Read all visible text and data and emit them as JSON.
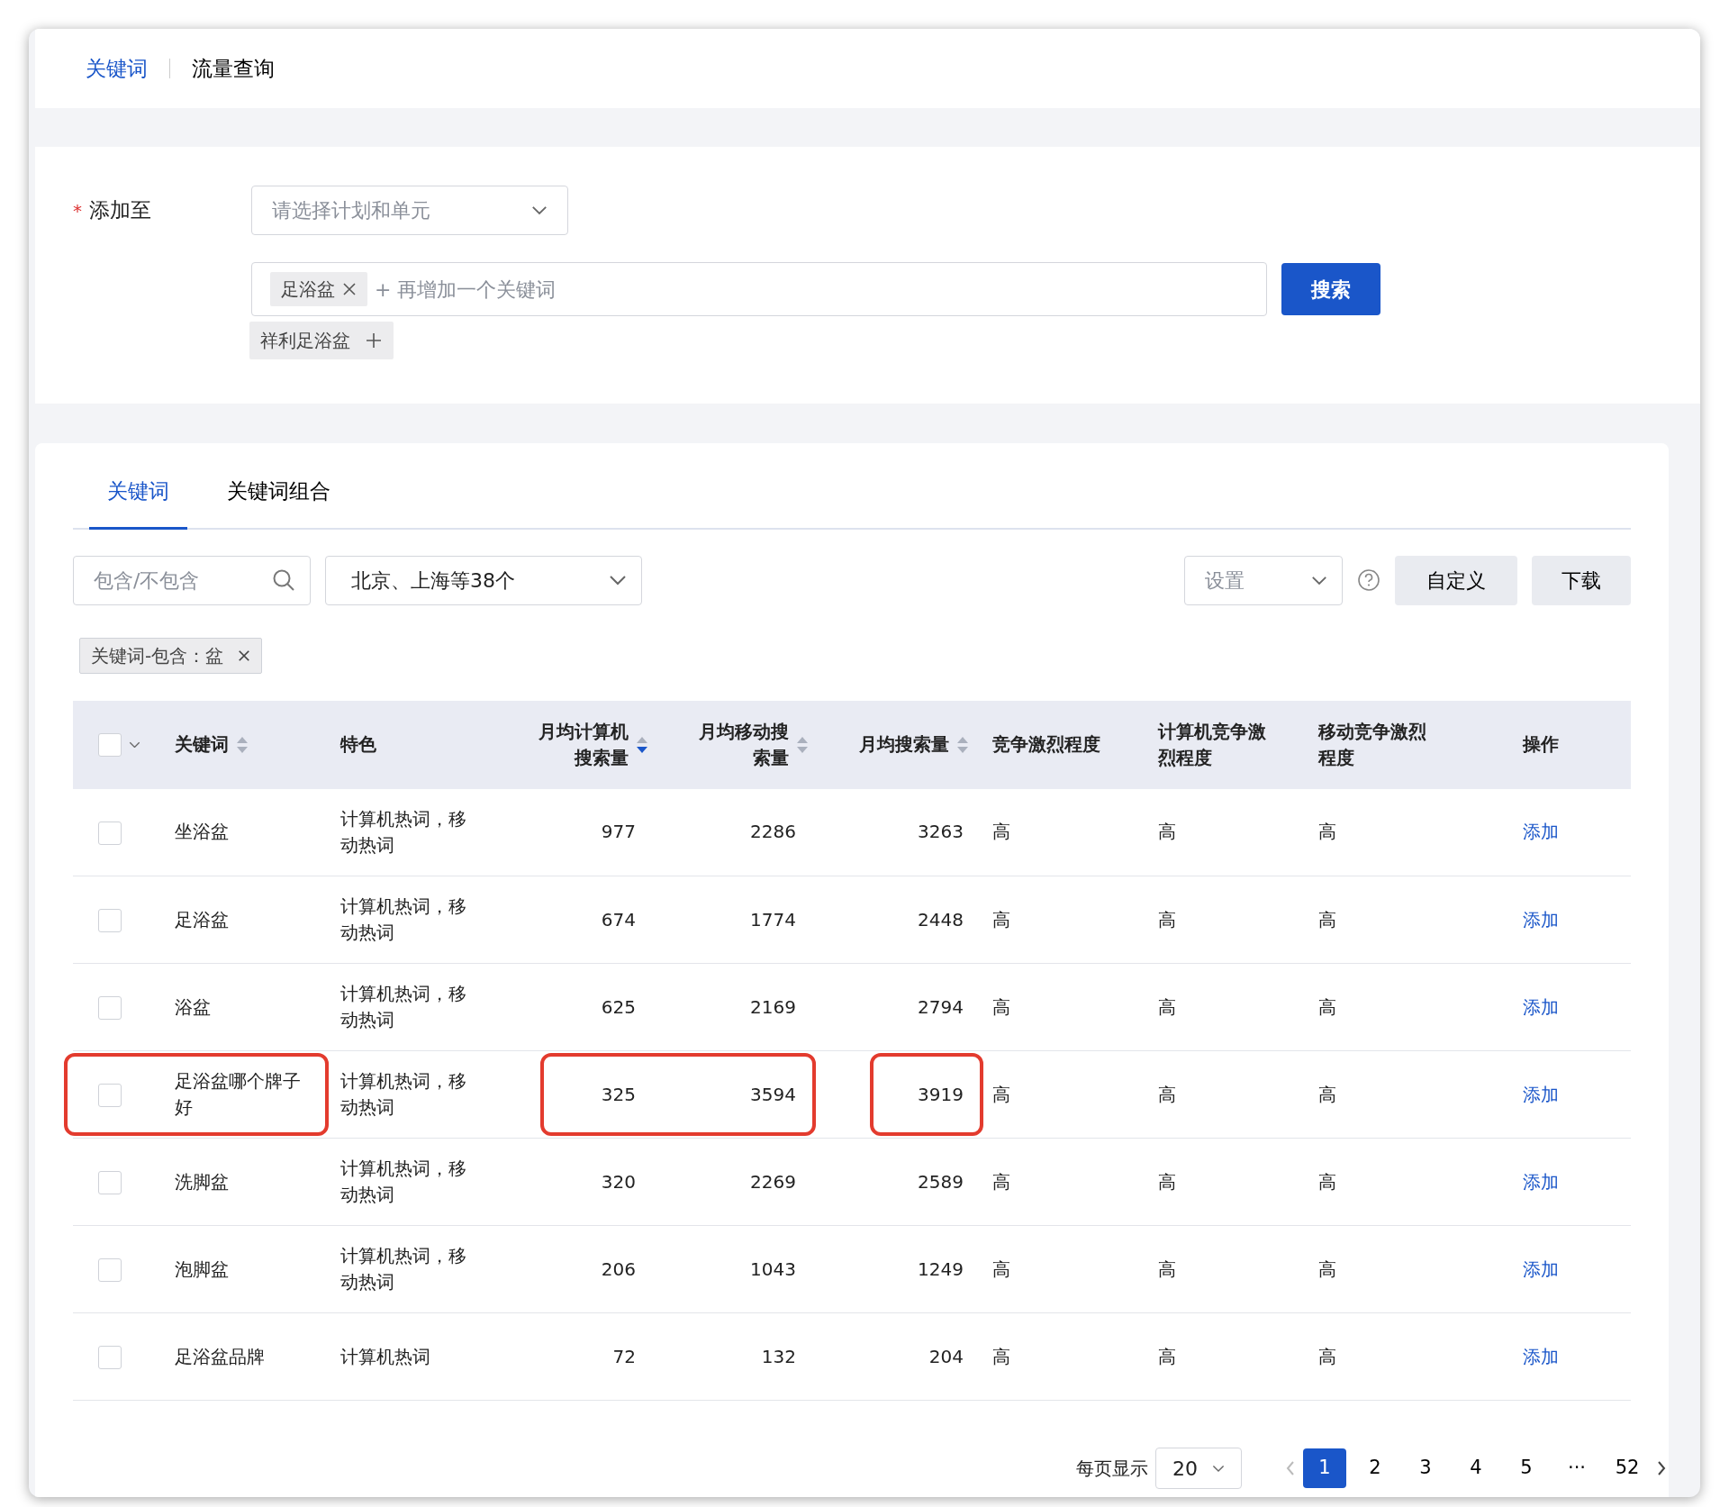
{
  "top_tabs": [
    {
      "label": "关键词",
      "selected": true
    },
    {
      "label": "流量查询",
      "selected": false
    }
  ],
  "form": {
    "add_to_label": "添加至",
    "required_mark": "*",
    "plan_placeholder": "请选择计划和单元",
    "keyword_tags": [
      "足浴盆"
    ],
    "keyword_placeholder": "+ 再增加一个关键词",
    "search_button": "搜索",
    "suggestions": [
      "祥利足浴盆"
    ]
  },
  "result_tabs": [
    {
      "label": "关键词",
      "selected": true
    },
    {
      "label": "关键词组合",
      "selected": false
    }
  ],
  "filters": {
    "search_placeholder": "包含/不包含",
    "region": "北京、上海等38个",
    "settings_placeholder": "设置",
    "buttons": [
      "自定义",
      "下载"
    ]
  },
  "active_filters": [
    "关键词-包含：盆"
  ],
  "table": {
    "all_checked": false,
    "columns": [
      {
        "label": "关键词",
        "kind": "text",
        "sortable": true,
        "sorted": false
      },
      {
        "label": "特色",
        "kind": "text"
      },
      {
        "label": "月均计算机搜索量",
        "kind": "number",
        "sortable": true,
        "sorted": true
      },
      {
        "label": "月均移动搜索量",
        "kind": "number",
        "sortable": true,
        "sorted": false
      },
      {
        "label": "月均搜索量",
        "kind": "number",
        "sortable": true,
        "sorted": false
      },
      {
        "label": "竞争激烈程度",
        "kind": "text"
      },
      {
        "label": "计算机竞争激烈程度",
        "kind": "text"
      },
      {
        "label": "移动竞争激烈程度",
        "kind": "text"
      },
      {
        "label": "操作",
        "kind": "text"
      }
    ],
    "rows": [
      {
        "checked": false,
        "highlighted": false,
        "cells": [
          "坐浴盆",
          "计算机热词，移动热词",
          "977",
          "2286",
          "3263",
          "高",
          "高",
          "高"
        ],
        "action": "添加"
      },
      {
        "checked": false,
        "highlighted": false,
        "cells": [
          "足浴盆",
          "计算机热词，移动热词",
          "674",
          "1774",
          "2448",
          "高",
          "高",
          "高"
        ],
        "action": "添加"
      },
      {
        "checked": false,
        "highlighted": false,
        "cells": [
          "浴盆",
          "计算机热词，移动热词",
          "625",
          "2169",
          "2794",
          "高",
          "高",
          "高"
        ],
        "action": "添加"
      },
      {
        "checked": false,
        "highlighted": true,
        "cells": [
          "足浴盆哪个牌子好",
          "计算机热词，移动热词",
          "325",
          "3594",
          "3919",
          "高",
          "高",
          "高"
        ],
        "action": "添加"
      },
      {
        "checked": false,
        "highlighted": false,
        "cells": [
          "洗脚盆",
          "计算机热词，移动热词",
          "320",
          "2269",
          "2589",
          "高",
          "高",
          "高"
        ],
        "action": "添加"
      },
      {
        "checked": false,
        "highlighted": false,
        "cells": [
          "泡脚盆",
          "计算机热词，移动热词",
          "206",
          "1043",
          "1249",
          "高",
          "高",
          "高"
        ],
        "action": "添加"
      },
      {
        "checked": false,
        "highlighted": false,
        "cells": [
          "足浴盆品牌",
          "计算机热词",
          "72",
          "132",
          "204",
          "高",
          "高",
          "高"
        ],
        "action": "添加"
      }
    ]
  },
  "pagination": {
    "page_size_label": "每页显示",
    "page_size": "20",
    "pages": [
      {
        "label": "1",
        "selected": true
      },
      {
        "label": "2",
        "selected": false
      },
      {
        "label": "3",
        "selected": false
      },
      {
        "label": "4",
        "selected": false
      },
      {
        "label": "5",
        "selected": false
      },
      {
        "label": "···",
        "selected": false
      },
      {
        "label": "52",
        "selected": false
      }
    ]
  }
}
